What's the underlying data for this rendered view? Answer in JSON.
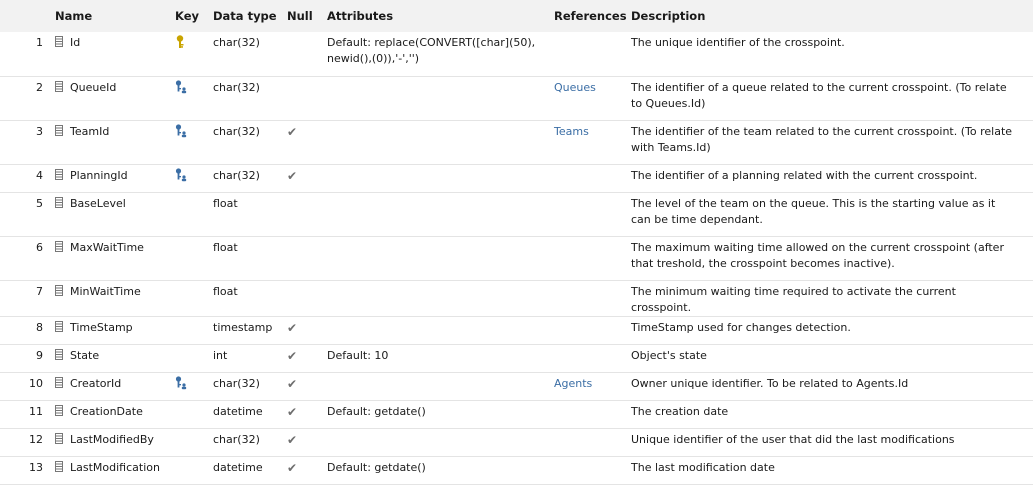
{
  "headers": {
    "name": "Name",
    "key": "Key",
    "datatype": "Data type",
    "null": "Null",
    "attributes": "Attributes",
    "references": "References",
    "description": "Description"
  },
  "colors": {
    "header_bg": "#f2f2f2",
    "link": "#3b6ea5",
    "primary_key_icon": "#c9a400",
    "foreign_key_icon": "#3b6ea5",
    "check": "#6e6e6e"
  },
  "rows": [
    {
      "num": "1",
      "name": "Id",
      "key": "primary-key",
      "datatype": "char(32)",
      "null": false,
      "attributes": "Default: replace(CONVERT([char](50),newid(),(0)),'-','')",
      "references": "",
      "description": "The unique identifier of the crosspoint."
    },
    {
      "num": "2",
      "name": "QueueId",
      "key": "foreign-key",
      "datatype": "char(32)",
      "null": false,
      "attributes": "",
      "references": "Queues",
      "description": "The identifier of a queue related to the current crosspoint. (To relate to Queues.Id)"
    },
    {
      "num": "3",
      "name": "TeamId",
      "key": "foreign-key",
      "datatype": "char(32)",
      "null": true,
      "attributes": "",
      "references": "Teams",
      "description": "The identifier of the team related to the current crosspoint. (To relate with Teams.Id)"
    },
    {
      "num": "4",
      "name": "PlanningId",
      "key": "foreign-key",
      "datatype": "char(32)",
      "null": true,
      "attributes": "",
      "references": "",
      "description": "The identifier of a planning related with the current crosspoint."
    },
    {
      "num": "5",
      "name": "BaseLevel",
      "key": "",
      "datatype": "float",
      "null": false,
      "attributes": "",
      "references": "",
      "description": "The level of the team on the queue. This is the starting value as it can be time dependant."
    },
    {
      "num": "6",
      "name": "MaxWaitTime",
      "key": "",
      "datatype": "float",
      "null": false,
      "attributes": "",
      "references": "",
      "description": "The maximum waiting time allowed on the current crosspoint (after that treshold, the crosspoint becomes inactive)."
    },
    {
      "num": "7",
      "name": "MinWaitTime",
      "key": "",
      "datatype": "float",
      "null": false,
      "attributes": "",
      "references": "",
      "description": "The minimum waiting time required to activate the current crosspoint."
    },
    {
      "num": "8",
      "name": "TimeStamp",
      "key": "",
      "datatype": "timestamp",
      "null": true,
      "attributes": "",
      "references": "",
      "description": "TimeStamp used for changes detection."
    },
    {
      "num": "9",
      "name": "State",
      "key": "",
      "datatype": "int",
      "null": true,
      "attributes": "Default: 10",
      "references": "",
      "description": "Object's state"
    },
    {
      "num": "10",
      "name": "CreatorId",
      "key": "foreign-key",
      "datatype": "char(32)",
      "null": true,
      "attributes": "",
      "references": "Agents",
      "description": "Owner unique identifier. To be related to Agents.Id"
    },
    {
      "num": "11",
      "name": "CreationDate",
      "key": "",
      "datatype": "datetime",
      "null": true,
      "attributes": "Default: getdate()",
      "references": "",
      "description": "The creation date"
    },
    {
      "num": "12",
      "name": "LastModifiedBy",
      "key": "",
      "datatype": "char(32)",
      "null": true,
      "attributes": "",
      "references": "",
      "description": "Unique identifier of the user that did the last modifications"
    },
    {
      "num": "13",
      "name": "LastModification",
      "key": "",
      "datatype": "datetime",
      "null": true,
      "attributes": "Default: getdate()",
      "references": "",
      "description": "The last modification date"
    }
  ]
}
